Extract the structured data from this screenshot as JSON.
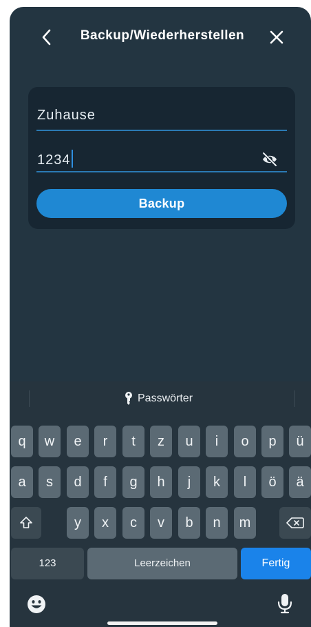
{
  "header": {
    "title": "Backup/Wiederherstellen",
    "back_icon": "chevron-left-icon",
    "close_icon": "close-icon"
  },
  "form": {
    "name_value": "Zuhause",
    "password_value": "1234",
    "visibility_icon": "eye-slash-icon",
    "backup_label": "Backup"
  },
  "keyboard": {
    "suggestion_label": "Passwörter",
    "suggestion_icon": "key-icon",
    "row1": [
      "q",
      "w",
      "e",
      "r",
      "t",
      "z",
      "u",
      "i",
      "o",
      "p",
      "ü"
    ],
    "row2": [
      "a",
      "s",
      "d",
      "f",
      "g",
      "h",
      "j",
      "k",
      "l",
      "ö",
      "ä"
    ],
    "row3": [
      "y",
      "x",
      "c",
      "v",
      "b",
      "n",
      "m"
    ],
    "numbers_label": "123",
    "space_label": "Leerzeichen",
    "return_label": "Fertig",
    "shift_icon": "shift-icon",
    "delete_icon": "backspace-icon",
    "emoji_icon": "emoji-icon",
    "mic_icon": "microphone-icon"
  },
  "colors": {
    "background": "#233541",
    "card": "#172632",
    "accent": "#1f88d3",
    "return_key": "#1a83ea"
  }
}
